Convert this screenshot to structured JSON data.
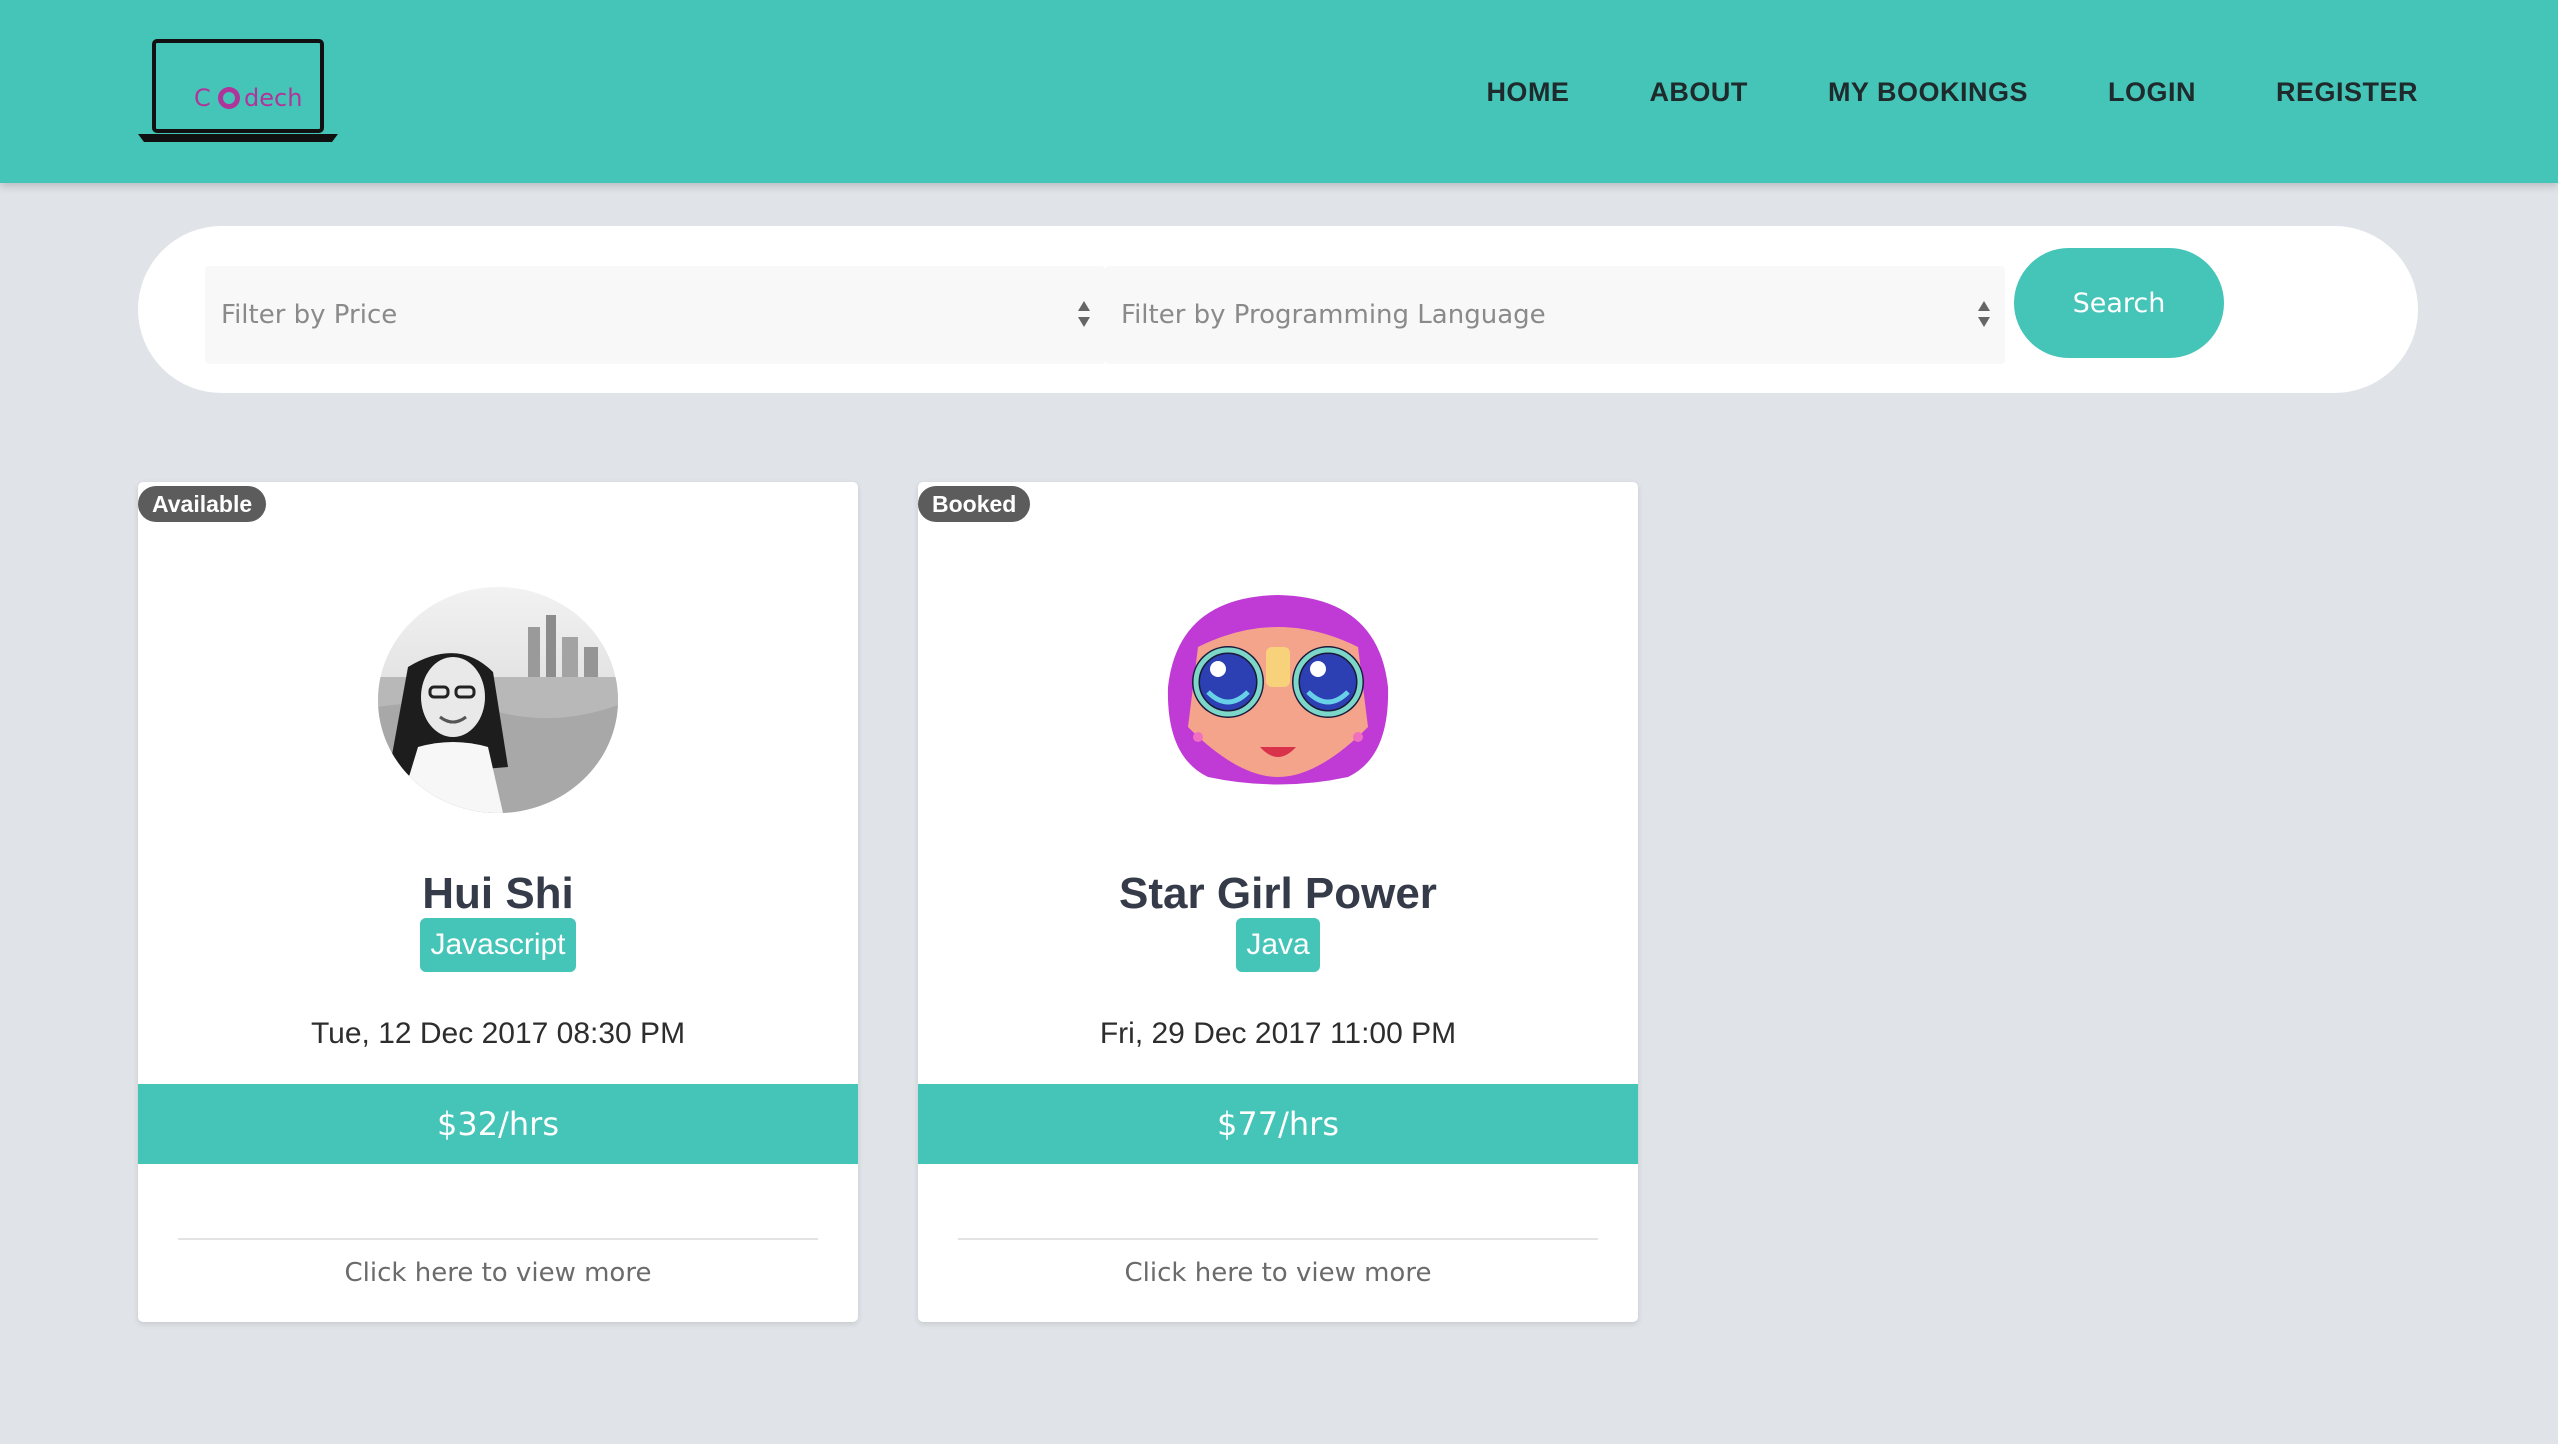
{
  "nav": {
    "logo_text": "Codech",
    "items": [
      {
        "label": "HOME"
      },
      {
        "label": "ABOUT"
      },
      {
        "label": "MY BOOKINGS"
      },
      {
        "label": "LOGIN"
      },
      {
        "label": "REGISTER"
      }
    ]
  },
  "search": {
    "price_placeholder": "Filter by Price",
    "language_placeholder": "Filter by Programming Language",
    "button_label": "Search"
  },
  "cards": [
    {
      "status": "Available",
      "name": "Hui Shi",
      "language": "Javascript",
      "datetime": "Tue, 12 Dec 2017 08:30 PM",
      "price": "$32/hrs",
      "link": "Click here to view more"
    },
    {
      "status": "Booked",
      "name": "Star Girl Power",
      "language": "Java",
      "datetime": "Fri, 29 Dec 2017 11:00 PM",
      "price": "$77/hrs",
      "link": "Click here to view more"
    }
  ],
  "colors": {
    "primary": "#45c4b8",
    "background": "#e0e4e8",
    "badge": "#5c5c5c",
    "heading": "#363b4a",
    "logo_text": "#b0359a"
  }
}
